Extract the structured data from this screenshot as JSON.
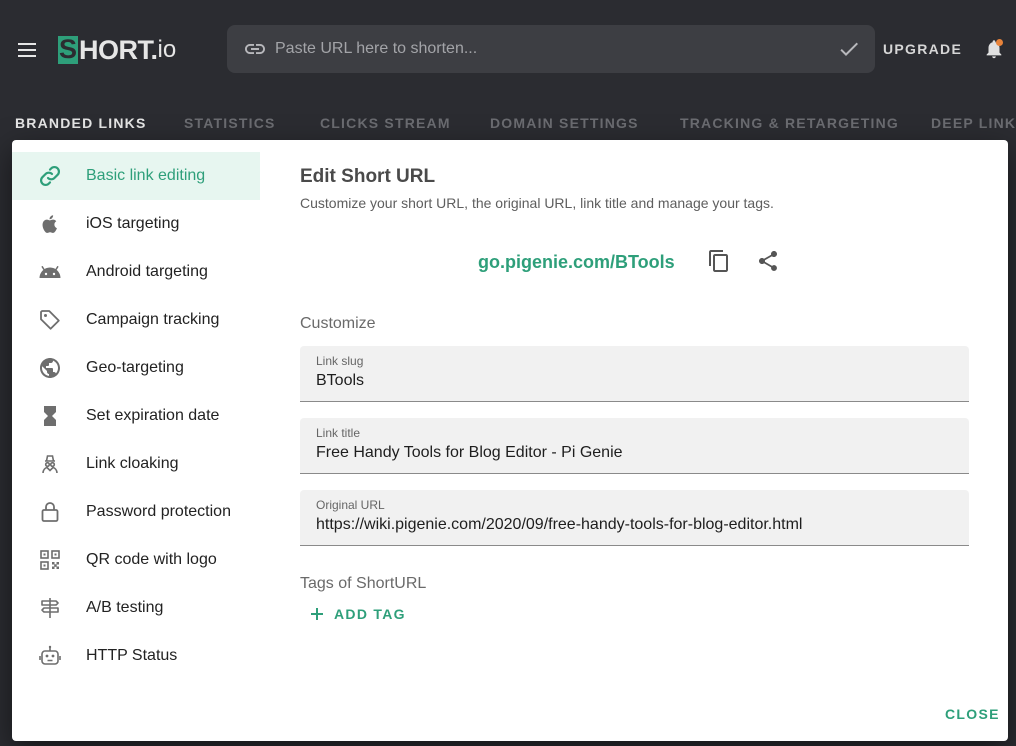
{
  "header": {
    "logo_text": "SHORT.io",
    "search_placeholder": "Paste URL here to shorten...",
    "upgrade_label": "UPGRADE",
    "notification_dot_color": "#e8833a"
  },
  "nav_tabs": [
    {
      "label": "BRANDED LINKS",
      "active": true
    },
    {
      "label": "STATISTICS",
      "active": false
    },
    {
      "label": "CLICKS STREAM",
      "active": false
    },
    {
      "label": "DOMAIN SETTINGS",
      "active": false
    },
    {
      "label": "TRACKING & RETARGETING",
      "active": false
    },
    {
      "label": "DEEP LINKS",
      "active": false
    }
  ],
  "sidebar": {
    "items": [
      {
        "label": "Basic link editing",
        "icon": "link-icon",
        "active": true
      },
      {
        "label": "iOS targeting",
        "icon": "apple-icon"
      },
      {
        "label": "Android targeting",
        "icon": "android-icon"
      },
      {
        "label": "Campaign tracking",
        "icon": "tag-icon"
      },
      {
        "label": "Geo-targeting",
        "icon": "globe-icon"
      },
      {
        "label": "Set expiration date",
        "icon": "hourglass-icon"
      },
      {
        "label": "Link cloaking",
        "icon": "spy-icon"
      },
      {
        "label": "Password protection",
        "icon": "lock-icon"
      },
      {
        "label": "QR code with logo",
        "icon": "qr-code-icon"
      },
      {
        "label": "A/B testing",
        "icon": "signpost-icon"
      },
      {
        "label": "HTTP Status",
        "icon": "robot-icon"
      }
    ]
  },
  "main": {
    "title": "Edit Short URL",
    "subtitle": "Customize your short URL, the original URL, link title and manage your tags.",
    "short_url": "go.pigenie.com/BTools",
    "customize_label": "Customize",
    "fields": [
      {
        "label": "Link slug",
        "value": "BTools"
      },
      {
        "label": "Link title",
        "value": "Free Handy Tools for Blog Editor - Pi Genie"
      },
      {
        "label": "Original URL",
        "value": "https://wiki.pigenie.com/2020/09/free-handy-tools-for-blog-editor.html"
      }
    ],
    "tags_label": "Tags of ShortURL",
    "add_tag_label": "ADD TAG",
    "close_label": "CLOSE"
  },
  "colors": {
    "accent": "#2e9f7a",
    "topbar_bg": "#2b2c31",
    "active_item_bg": "#e7f6f0"
  }
}
